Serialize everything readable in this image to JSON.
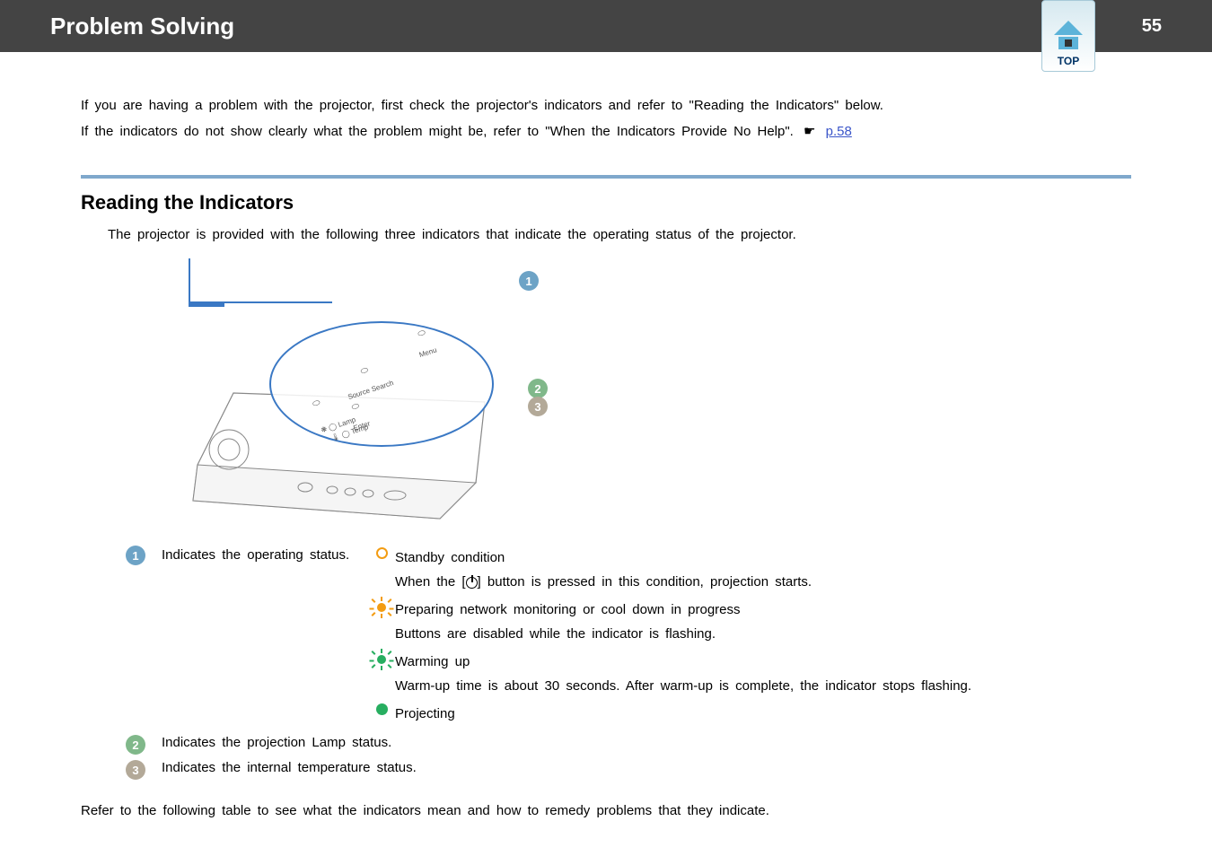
{
  "header": {
    "title": "Problem Solving",
    "page_number": "55",
    "top_label": "TOP"
  },
  "intro": {
    "line1": "If you are having a problem with the projector, first check the projector's indicators and refer to \"Reading the Indicators\" below.",
    "line2_a": "If the indicators do not show clearly what the problem might be, refer to \"When the Indicators Provide No Help\".",
    "line2_link": "p.58"
  },
  "section": {
    "title": "Reading the Indicators",
    "desc": "The projector is provided with the following three indicators that indicate the operating status of the projector."
  },
  "diagram": {
    "m1": "1",
    "m2": "2",
    "m3": "3",
    "labels": {
      "menu": "Menu",
      "source": "Source Search",
      "enter": "Enter",
      "lamp": "Lamp",
      "temp": "Temp"
    }
  },
  "legend": {
    "item1": {
      "num": "1",
      "label": "Indicates the operating status.",
      "status1_title": "Standby condition",
      "status1_desc_a": "When the [",
      "status1_desc_b": "] button is pressed in this condition, projection starts.",
      "status2_title": "Preparing network monitoring or cool down in progress",
      "status2_desc": "Buttons are disabled while the indicator is flashing.",
      "status3_title": "Warming up",
      "status3_desc": "Warm-up time is about 30 seconds. After warm-up is complete, the indicator stops flashing.",
      "status4_title": "Projecting"
    },
    "item2": {
      "num": "2",
      "label": "Indicates the projection Lamp status."
    },
    "item3": {
      "num": "3",
      "label": "Indicates the internal temperature status."
    }
  },
  "closing": "Refer to the following table to see what the indicators mean and how to remedy problems that they indicate."
}
